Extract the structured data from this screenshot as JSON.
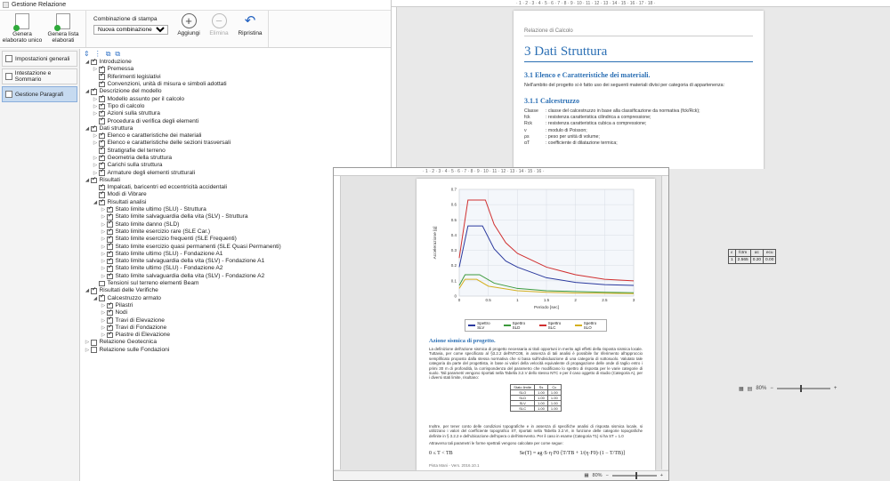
{
  "app": {
    "title": "Gestione Relazione",
    "ribbon": {
      "generate_single": "Genera elaborato unico",
      "generate_list": "Genera lista elaborati",
      "combo_label": "Combinazione di stampa",
      "combo_value": "Nuova combinazione",
      "add": "Aggiungi",
      "delete": "Elimina",
      "restore": "Ripristina"
    },
    "nav": [
      {
        "label": "Impostazioni generali",
        "active": false
      },
      {
        "label": "Intestazione e Sommario",
        "active": false
      },
      {
        "label": "Gestione Paragrafi",
        "active": true
      }
    ],
    "tree": [
      {
        "level": 0,
        "exp": "open",
        "checked": true,
        "label": "Introduzione"
      },
      {
        "level": 1,
        "exp": "closed",
        "checked": true,
        "label": "Premessa"
      },
      {
        "level": 1,
        "exp": "",
        "checked": true,
        "label": "Riferimenti legislativi"
      },
      {
        "level": 1,
        "exp": "",
        "checked": true,
        "label": "Convenzioni, unità di misura e simboli adottati"
      },
      {
        "level": 0,
        "exp": "open",
        "checked": true,
        "label": "Descrizione del modello"
      },
      {
        "level": 1,
        "exp": "closed",
        "checked": true,
        "label": "Modello assunto per il calcolo"
      },
      {
        "level": 1,
        "exp": "closed",
        "checked": true,
        "label": "Tipo di calcolo"
      },
      {
        "level": 1,
        "exp": "closed",
        "checked": true,
        "label": "Azioni sulla struttura"
      },
      {
        "level": 1,
        "exp": "",
        "checked": true,
        "label": "Procedura di verifica degli elementi"
      },
      {
        "level": 0,
        "exp": "open",
        "checked": true,
        "label": "Dati struttura"
      },
      {
        "level": 1,
        "exp": "closed",
        "checked": true,
        "label": "Elenco e caratteristiche dei materiali"
      },
      {
        "level": 1,
        "exp": "closed",
        "checked": true,
        "label": "Elenco e caratteristiche delle sezioni trasversali"
      },
      {
        "level": 1,
        "exp": "",
        "checked": true,
        "label": "Stratigrafie del terreno"
      },
      {
        "level": 1,
        "exp": "closed",
        "checked": true,
        "label": "Geometria della struttura"
      },
      {
        "level": 1,
        "exp": "closed",
        "checked": true,
        "label": "Carichi sulla struttura"
      },
      {
        "level": 1,
        "exp": "closed",
        "checked": true,
        "label": "Armature degli elementi strutturali"
      },
      {
        "level": 0,
        "exp": "open",
        "checked": true,
        "label": "Risultati"
      },
      {
        "level": 1,
        "exp": "",
        "checked": true,
        "label": "Impalcati, baricentri ed eccentricità accidentali"
      },
      {
        "level": 1,
        "exp": "",
        "checked": true,
        "label": "Modi di Vibrare"
      },
      {
        "level": 1,
        "exp": "open",
        "checked": true,
        "label": "Risultati analisi"
      },
      {
        "level": 2,
        "exp": "closed",
        "checked": true,
        "label": "Stato limite ultimo (SLU) - Struttura"
      },
      {
        "level": 2,
        "exp": "closed",
        "checked": true,
        "label": "Stato limite salvaguardia della vita (SLV) - Struttura"
      },
      {
        "level": 2,
        "exp": "closed",
        "checked": true,
        "label": "Stato limite danno (SLD)"
      },
      {
        "level": 2,
        "exp": "closed",
        "checked": true,
        "label": "Stato limite esercizio rare (SLE Car.)"
      },
      {
        "level": 2,
        "exp": "closed",
        "checked": true,
        "label": "Stato limite esercizio frequenti (SLE Frequenti)"
      },
      {
        "level": 2,
        "exp": "closed",
        "checked": true,
        "label": "Stato limite esercizio quasi permanenti (SLE Quasi Permanenti)"
      },
      {
        "level": 2,
        "exp": "closed",
        "checked": true,
        "label": "Stato limite ultimo (SLU) - Fondazione A1"
      },
      {
        "level": 2,
        "exp": "closed",
        "checked": true,
        "label": "Stato limite salvaguardia della vita (SLV) - Fondazione A1"
      },
      {
        "level": 2,
        "exp": "closed",
        "checked": true,
        "label": "Stato limite ultimo (SLU) - Fondazione A2"
      },
      {
        "level": 2,
        "exp": "closed",
        "checked": true,
        "label": "Stato limite salvaguardia della vita (SLV) - Fondazione A2"
      },
      {
        "level": 1,
        "exp": "",
        "checked": false,
        "label": "Tensioni sul terreno elementi Beam"
      },
      {
        "level": 0,
        "exp": "open",
        "checked": true,
        "label": "Risultati delle Verifiche"
      },
      {
        "level": 1,
        "exp": "open",
        "checked": true,
        "label": "Calcestruzzo armato"
      },
      {
        "level": 2,
        "exp": "closed",
        "checked": true,
        "label": "Pilastri"
      },
      {
        "level": 2,
        "exp": "closed",
        "checked": true,
        "label": "Nodi"
      },
      {
        "level": 2,
        "exp": "closed",
        "checked": true,
        "label": "Travi di Elevazione"
      },
      {
        "level": 2,
        "exp": "closed",
        "checked": true,
        "label": "Travi di Fondazione"
      },
      {
        "level": 2,
        "exp": "closed",
        "checked": true,
        "label": "Piastre di Elevazione"
      },
      {
        "level": 0,
        "exp": "closed",
        "checked": false,
        "label": "Relazione Geotecnica"
      },
      {
        "level": 0,
        "exp": "closed",
        "checked": false,
        "label": "Relazione sulle Fondazioni"
      }
    ]
  },
  "doc1": {
    "header": "Relazione di Calcolo",
    "h1": "3 Dati Struttura",
    "h2a": "3.1 Elenco e Caratteristiche dei materiali.",
    "intro": "Nell'ambito del progetto si è fatto uso dei seguenti materiali divisi per categoria di appartenenza:",
    "h2b": "3.1.1 Calcestruzzo",
    "defs": [
      [
        "Classe",
        ": classe del calcestruzzo in base alla classificazione da normativa (fck/Rck);"
      ],
      [
        "fck",
        ": resistenza caratteristica cilindrica a compressione;"
      ],
      [
        "Rck",
        ": resistenza caratteristica cubica a compressione;"
      ],
      [
        "ν",
        ": modulo di Poisson;"
      ],
      [
        "ρs",
        ": peso per unità di volume;"
      ],
      [
        "αT",
        ": coefficiente di dilatazione termica;"
      ]
    ],
    "tbl_head": [
      "ε",
      "fctm",
      "αc",
      "ecu"
    ],
    "tbl_row": [
      "1",
      "2.565",
      "0.20",
      "0.00"
    ],
    "zoom": "80%"
  },
  "doc2": {
    "chart_data": {
      "type": "line",
      "xlabel": "Periodo [sec]",
      "ylabel": "Accelerazione [g]",
      "xlim": [
        0,
        3
      ],
      "ylim": [
        0,
        0.7
      ],
      "xticks": [
        "0",
        "0.5",
        "1",
        "1.5",
        "2",
        "2.5",
        "3"
      ],
      "yticks": [
        "0",
        "0.1",
        "0.2",
        "0.3",
        "0.4",
        "0.5",
        "0.6",
        "0.7"
      ],
      "series": [
        {
          "name": "Spettro SLV",
          "color": "#2b3a9e",
          "x": [
            0,
            0.15,
            0.4,
            0.6,
            0.8,
            1.0,
            1.5,
            2.0,
            2.5,
            3.0
          ],
          "y": [
            0.19,
            0.46,
            0.46,
            0.31,
            0.23,
            0.19,
            0.12,
            0.09,
            0.075,
            0.07
          ]
        },
        {
          "name": "Spettro SLD",
          "color": "#3c9a3c",
          "x": [
            0,
            0.1,
            0.35,
            0.6,
            1.0,
            1.5,
            2.0,
            2.5,
            3.0
          ],
          "y": [
            0.07,
            0.14,
            0.14,
            0.085,
            0.05,
            0.035,
            0.03,
            0.025,
            0.022
          ]
        },
        {
          "name": "Spettro SLC",
          "color": "#d03030",
          "x": [
            0,
            0.15,
            0.45,
            0.6,
            0.8,
            1.0,
            1.5,
            2.0,
            2.5,
            3.0
          ],
          "y": [
            0.25,
            0.63,
            0.63,
            0.47,
            0.35,
            0.28,
            0.19,
            0.14,
            0.11,
            0.1
          ]
        },
        {
          "name": "Spettro SLO",
          "color": "#d4b020",
          "x": [
            0,
            0.1,
            0.3,
            0.5,
            1.0,
            1.5,
            2.0,
            2.5,
            3.0
          ],
          "y": [
            0.05,
            0.11,
            0.11,
            0.065,
            0.035,
            0.025,
            0.02,
            0.018,
            0.016
          ]
        }
      ]
    },
    "h3": "Azione sismica di progetto.",
    "para1": "La definizione dell'azione sismica di progetto necessaria ai titoli opportuni in merito agli effetti della risposta sismica locale. Tuttavia, per come specificato al §3.2.2 dell'NTC08, in assenza di tali analisi è possibile far riferimento all'approccio semplificato proposto dalla stessa normativa che si basa sull'individuazione di una categoria di sottosuolo. Valutato tale categoria da parte del progettista, in base ai valori della velocità equivalente di propagazione delle onde di taglio entro i primi 30 m di profondità, la corrispondenza del parametro che modificano lo spettro di risposta per le varie categorie di suolo. Tali parametri vengono riportati nella Tabella 3.2.V dello stesso NTC e per il caso oggetto di studio (Categoria A), per i diversi stati limite, risultano:",
    "mini_head": [
      "Stato limite",
      "Ss",
      "Cc"
    ],
    "mini_rows": [
      [
        "SLO",
        "1.00",
        "1.00"
      ],
      [
        "SLD",
        "1.00",
        "1.00"
      ],
      [
        "SLV",
        "1.00",
        "1.00"
      ],
      [
        "SLC",
        "1.00",
        "1.00"
      ]
    ],
    "para2": "Inoltre, per tener conto delle condizioni topografiche e in assenza di specifiche analisi di risposta sismica locale, si utilizzano i valori del coefficiente topografico ST, riportati nella Tabella 3.2.VI, in funzione delle categorie topografiche definite in § 3.2.2 e dell'ubicazione dell'opera o dell'intervento. Per il caso in esame (Categoria T1) si ha ST = 1.0",
    "para3": "Attraverso tali parametri le forme spettrali vengono calcolate per come segue:",
    "f_left": "0 ≤ T < TB",
    "f_right": "Se(T) = ag·S·η·F0·[T/TB + 1/(η·F0)·(1 − T/TB)]",
    "footer": "Pista Mani - Vers. 2016.10.1",
    "zoom": "80%"
  }
}
